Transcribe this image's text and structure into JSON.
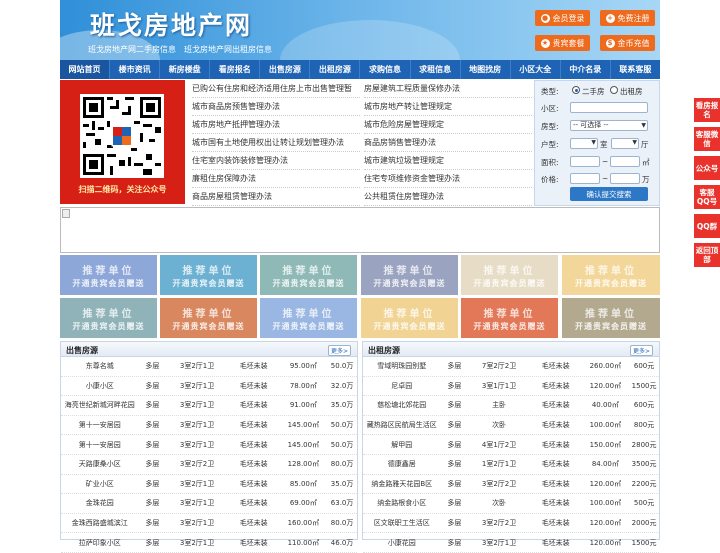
{
  "header": {
    "title": "班戈房地产网",
    "links": [
      "班戈房地产网二手房信息",
      "班戈房地产网出租房信息"
    ],
    "buttons": [
      {
        "label": "会员登录",
        "icon": "user-icon"
      },
      {
        "label": "免费注册",
        "icon": "register-icon"
      },
      {
        "label": "贵宾套餐",
        "icon": "vip-icon"
      },
      {
        "label": "金币充值",
        "icon": "coin-icon"
      }
    ]
  },
  "nav": [
    "网站首页",
    "楼市资讯",
    "新房楼盘",
    "看房报名",
    "出售房源",
    "出租房源",
    "求购信息",
    "求租信息",
    "地图找房",
    "小区大全",
    "中介名录",
    "联系客服"
  ],
  "qr": {
    "caption": "扫描二维码，关注公众号"
  },
  "news": {
    "left": [
      "已购公有住房和经济适用住房上市出售管理暂",
      "城市商品房预售管理办法",
      "城市房地产抵押管理办法",
      "城市国有土地使用权出让转让规划管理办法",
      "住宅室内装饰装修管理办法",
      "廉租住房保障办法",
      "商品房屋租赁管理办法"
    ],
    "right": [
      "房屋建筑工程质量保修办法",
      "城市房地产转让管理规定",
      "城市危险房屋管理规定",
      "商品房销售管理办法",
      "城市建筑垃圾管理规定",
      "住宅专项维修资金管理办法",
      "公共租赁住房管理办法"
    ]
  },
  "search": {
    "type_label": "类型:",
    "type_options": [
      "二手房",
      "出租房"
    ],
    "community_label": "小区:",
    "house_type_label": "房型:",
    "house_type_value": "-- 可选择 --",
    "layout_label": "户型:",
    "room_unit": "室",
    "hall_unit": "厅",
    "area_label": "面积:",
    "area_unit": "㎡",
    "price_label": "价格:",
    "price_unit": "万",
    "range_sep": "~",
    "submit_label": "确认提交搜索"
  },
  "promo": {
    "title": "推荐单位",
    "subtitle": "开通贵宾会员赠送"
  },
  "sale": {
    "title": "出售房源",
    "more": "更多>",
    "rows": [
      [
        "东尊名城",
        "多层",
        "3室2厅1卫",
        "毛坯未装",
        "95.00㎡",
        "50.0万"
      ],
      [
        "小康小区",
        "多层",
        "3室2厅1卫",
        "毛坯未装",
        "78.00㎡",
        "32.0万"
      ],
      [
        "海亮世纪新城河畔花园",
        "多层",
        "3室2厅1卫",
        "毛坯未装",
        "91.00㎡",
        "35.0万"
      ],
      [
        "第十一安居园",
        "多层",
        "3室2厅1卫",
        "毛坯未装",
        "145.00㎡",
        "50.0万"
      ],
      [
        "第十一安居园",
        "多层",
        "3室2厅1卫",
        "毛坯未装",
        "145.00㎡",
        "50.0万"
      ],
      [
        "天路康桑小区",
        "多层",
        "3室2厅2卫",
        "毛坯未装",
        "128.00㎡",
        "80.0万"
      ],
      [
        "矿业小区",
        "多层",
        "3室2厅1卫",
        "毛坯未装",
        "85.00㎡",
        "35.0万"
      ],
      [
        "金珠花园",
        "多层",
        "3室2厅1卫",
        "毛坯未装",
        "69.00㎡",
        "63.0万"
      ],
      [
        "金珠西路盛城滨江",
        "多层",
        "3室2厅1卫",
        "毛坯未装",
        "160.00㎡",
        "80.0万"
      ],
      [
        "拉萨印象小区",
        "多层",
        "3室2厅1卫",
        "毛坯未装",
        "110.00㎡",
        "46.0万"
      ]
    ]
  },
  "rent": {
    "title": "出租房源",
    "more": "更多>",
    "rows": [
      [
        "雪域明珠园别墅",
        "多层",
        "7室2厅2卫",
        "毛坯未装",
        "260.00㎡",
        "600元"
      ],
      [
        "尼卓园",
        "多层",
        "3室1厅1卫",
        "毛坯未装",
        "120.00㎡",
        "1500元"
      ],
      [
        "慈松塘北郊花园",
        "多层",
        "主卧",
        "毛坯未装",
        "40.00㎡",
        "600元"
      ],
      [
        "藏热路区民航局生活区",
        "多层",
        "次卧",
        "毛坯未装",
        "100.00㎡",
        "800元"
      ],
      [
        "解甲园",
        "多层",
        "4室1厅2卫",
        "毛坯未装",
        "150.00㎡",
        "2800元"
      ],
      [
        "德康鑫居",
        "多层",
        "1室2厅1卫",
        "毛坯未装",
        "84.00㎡",
        "3500元"
      ],
      [
        "纳金路雅天花园B区",
        "多层",
        "3室2厅2卫",
        "毛坯未装",
        "120.00㎡",
        "2200元"
      ],
      [
        "纳金路根食小区",
        "多层",
        "次卧",
        "毛坯未装",
        "100.00㎡",
        "500元"
      ],
      [
        "区文联职工生活区",
        "多层",
        "3室2厅2卫",
        "毛坯未装",
        "120.00㎡",
        "2000元"
      ],
      [
        "小康花园",
        "多层",
        "3室2厅1卫",
        "毛坯未装",
        "120.00㎡",
        "1500元"
      ]
    ]
  },
  "sidebar": [
    "看房报名",
    "客服微信",
    "公众号",
    "客服QQ号",
    "QQ群",
    "返回顶部"
  ],
  "colors": {
    "nav": "#1f63b4",
    "orange": "#ee6a1d",
    "sidebar": "#e8322b",
    "qr_bg": "#d72015"
  }
}
